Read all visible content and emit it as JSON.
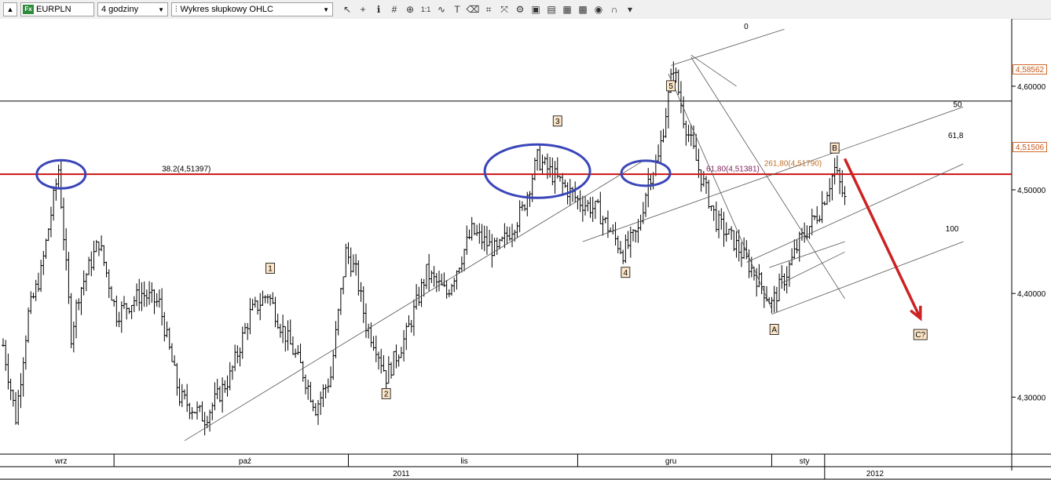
{
  "toolbar": {
    "symbol": "EURPLN",
    "interval": "4 godziny",
    "chart_type": "Wykres słupkowy OHLC",
    "tools": [
      {
        "name": "cursor-arrow-icon",
        "glyph": "↖"
      },
      {
        "name": "crosshair-icon",
        "glyph": "+"
      },
      {
        "name": "info-icon",
        "glyph": "ℹ"
      },
      {
        "name": "grid-icon",
        "glyph": "#"
      },
      {
        "name": "zoom-icon",
        "glyph": "⊕"
      },
      {
        "name": "ratio-icon",
        "glyph": "1:1"
      },
      {
        "name": "wave-icon",
        "glyph": "∿"
      },
      {
        "name": "text-icon",
        "glyph": "T"
      },
      {
        "name": "eraser-icon",
        "glyph": "⌫"
      },
      {
        "name": "chart-tool-icon",
        "glyph": "⌗"
      },
      {
        "name": "arrows-icon",
        "glyph": "⤧"
      },
      {
        "name": "tool-icon",
        "glyph": "⚙"
      },
      {
        "name": "image-icon",
        "glyph": "▣"
      },
      {
        "name": "image-alt-icon",
        "glyph": "▤"
      },
      {
        "name": "save-icon",
        "glyph": "▦"
      },
      {
        "name": "pattern-icon",
        "glyph": "▩"
      },
      {
        "name": "spiral-icon",
        "glyph": "◉"
      },
      {
        "name": "magnet-icon",
        "glyph": "∩"
      },
      {
        "name": "menu-arrow-icon",
        "glyph": "▾"
      }
    ]
  },
  "overlays": [
    "EURPLN",
    "Fibonacci 1",
    "Rozszerzenie Fibonacciego 1",
    "Fibonacci 2",
    "Pitchfork 1"
  ],
  "price_boxes": {
    "upper": "4,58562",
    "lower": "4,51506"
  },
  "chart_data": {
    "type": "ohlc",
    "symbol": "EURPLN",
    "ylim": [
      4.245,
      4.665
    ],
    "y_ticks": [
      4.3,
      4.4,
      4.5,
      4.6
    ],
    "y_tick_labels": [
      "4,30000",
      "4,40000",
      "4,50000",
      "4,60000"
    ],
    "horizontal_lines": [
      {
        "value": 4.5856,
        "color": "#000000"
      },
      {
        "value": 4.51506,
        "color": "#cc1111"
      }
    ],
    "month_labels": [
      {
        "label": "wrz",
        "bar": 23
      },
      {
        "label": "paź",
        "bar": 96
      },
      {
        "label": "lis",
        "bar": 183
      },
      {
        "label": "gru",
        "bar": 265
      },
      {
        "label": "sty",
        "bar": 318
      }
    ],
    "month_separators": [
      44,
      137,
      228,
      305,
      326
    ],
    "year_labels": [
      {
        "label": "2011",
        "bar": 158
      },
      {
        "label": "2012",
        "bar": 346
      }
    ],
    "year_separator": 326,
    "bar_count": 400,
    "anchors": [
      [
        0,
        4.35
      ],
      [
        5,
        4.28
      ],
      [
        10,
        4.38
      ],
      [
        15,
        4.42
      ],
      [
        22,
        4.52
      ],
      [
        27,
        4.36
      ],
      [
        30,
        4.4
      ],
      [
        38,
        4.45
      ],
      [
        45,
        4.38
      ],
      [
        55,
        4.4
      ],
      [
        62,
        4.39
      ],
      [
        70,
        4.3
      ],
      [
        80,
        4.28
      ],
      [
        90,
        4.32
      ],
      [
        98,
        4.38
      ],
      [
        105,
        4.4
      ],
      [
        110,
        4.37
      ],
      [
        118,
        4.33
      ],
      [
        124,
        4.29
      ],
      [
        130,
        4.32
      ],
      [
        136,
        4.44
      ],
      [
        140,
        4.42
      ],
      [
        144,
        4.37
      ],
      [
        148,
        4.35
      ],
      [
        152,
        4.32
      ],
      [
        160,
        4.36
      ],
      [
        168,
        4.42
      ],
      [
        176,
        4.4
      ],
      [
        186,
        4.46
      ],
      [
        196,
        4.44
      ],
      [
        206,
        4.48
      ],
      [
        212,
        4.53
      ],
      [
        220,
        4.51
      ],
      [
        228,
        4.49
      ],
      [
        236,
        4.48
      ],
      [
        246,
        4.44
      ],
      [
        252,
        4.46
      ],
      [
        256,
        4.51
      ],
      [
        260,
        4.53
      ],
      [
        266,
        4.62
      ],
      [
        270,
        4.57
      ],
      [
        276,
        4.52
      ],
      [
        283,
        4.47
      ],
      [
        290,
        4.45
      ],
      [
        298,
        4.42
      ],
      [
        305,
        4.39
      ],
      [
        311,
        4.42
      ],
      [
        316,
        4.45
      ],
      [
        324,
        4.48
      ],
      [
        330,
        4.52
      ],
      [
        334,
        4.49
      ]
    ],
    "rays": [
      {
        "name": "pitchfork-median",
        "from": [
          72,
          4.258
        ],
        "to": [
          254,
          4.528
        ]
      },
      {
        "name": "pitchfork-upper",
        "from": [
          265,
          4.62
        ],
        "to": [
          310,
          4.655
        ]
      },
      {
        "name": "pitchfork-mid",
        "from": [
          230,
          4.45
        ],
        "to": [
          381,
          4.58
        ]
      },
      {
        "name": "pitchfork-line-61",
        "from": [
          295,
          4.43
        ],
        "to": [
          381,
          4.525
        ]
      },
      {
        "name": "pitchfork-lower",
        "from": [
          305,
          4.38
        ],
        "to": [
          381,
          4.45
        ]
      },
      {
        "name": "fib-diag-1",
        "from": [
          264,
          4.612
        ],
        "to": [
          305,
          4.385
        ]
      },
      {
        "name": "fib-diag-2",
        "from": [
          273,
          4.628
        ],
        "to": [
          334,
          4.395
        ]
      },
      {
        "name": "fib-side-1",
        "from": [
          273,
          4.63
        ],
        "to": [
          291,
          4.6
        ]
      },
      {
        "name": "fib-side-2",
        "from": [
          309,
          4.41
        ],
        "to": [
          334,
          4.44
        ]
      },
      {
        "name": "fib-cross",
        "from": [
          304,
          4.425
        ],
        "to": [
          334,
          4.45
        ]
      }
    ],
    "level_labels": [
      {
        "text": "0",
        "bar": 294,
        "value": 4.655
      },
      {
        "text": "50",
        "bar": 377,
        "value": 4.58
      },
      {
        "text": "61,8",
        "bar": 375,
        "value": 4.55
      },
      {
        "text": "100",
        "bar": 374,
        "value": 4.46
      }
    ],
    "text_annotations": [
      {
        "text": "38.2(4,51397)",
        "bar": 63,
        "value": 4.518,
        "color": "#000000"
      },
      {
        "text": "61,80(4,51381)",
        "bar": 279,
        "value": 4.518,
        "color": "#7a1f5a"
      },
      {
        "text": "261,80(4,51790)",
        "bar": 302,
        "value": 4.523,
        "color": "#c0702a"
      }
    ],
    "wave_labels": [
      {
        "text": "1",
        "bar": 106,
        "value": 4.424
      },
      {
        "text": "2",
        "bar": 152,
        "value": 4.303
      },
      {
        "text": "3",
        "bar": 220,
        "value": 4.566
      },
      {
        "text": "4",
        "bar": 247,
        "value": 4.42
      },
      {
        "text": "5",
        "bar": 265,
        "value": 4.6
      },
      {
        "text": "A",
        "bar": 306,
        "value": 4.365
      },
      {
        "text": "B",
        "bar": 330,
        "value": 4.54
      },
      {
        "text": "C?",
        "bar": 364,
        "value": 4.36
      }
    ],
    "ellipses": [
      {
        "bar": 23,
        "value": 4.515
      },
      {
        "bar": 212,
        "value": 4.518
      },
      {
        "bar": 255,
        "value": 4.516
      }
    ],
    "forecast_arrow": {
      "from": [
        334,
        4.53
      ],
      "to": [
        364,
        4.376
      ],
      "color": "#cc2222"
    }
  }
}
